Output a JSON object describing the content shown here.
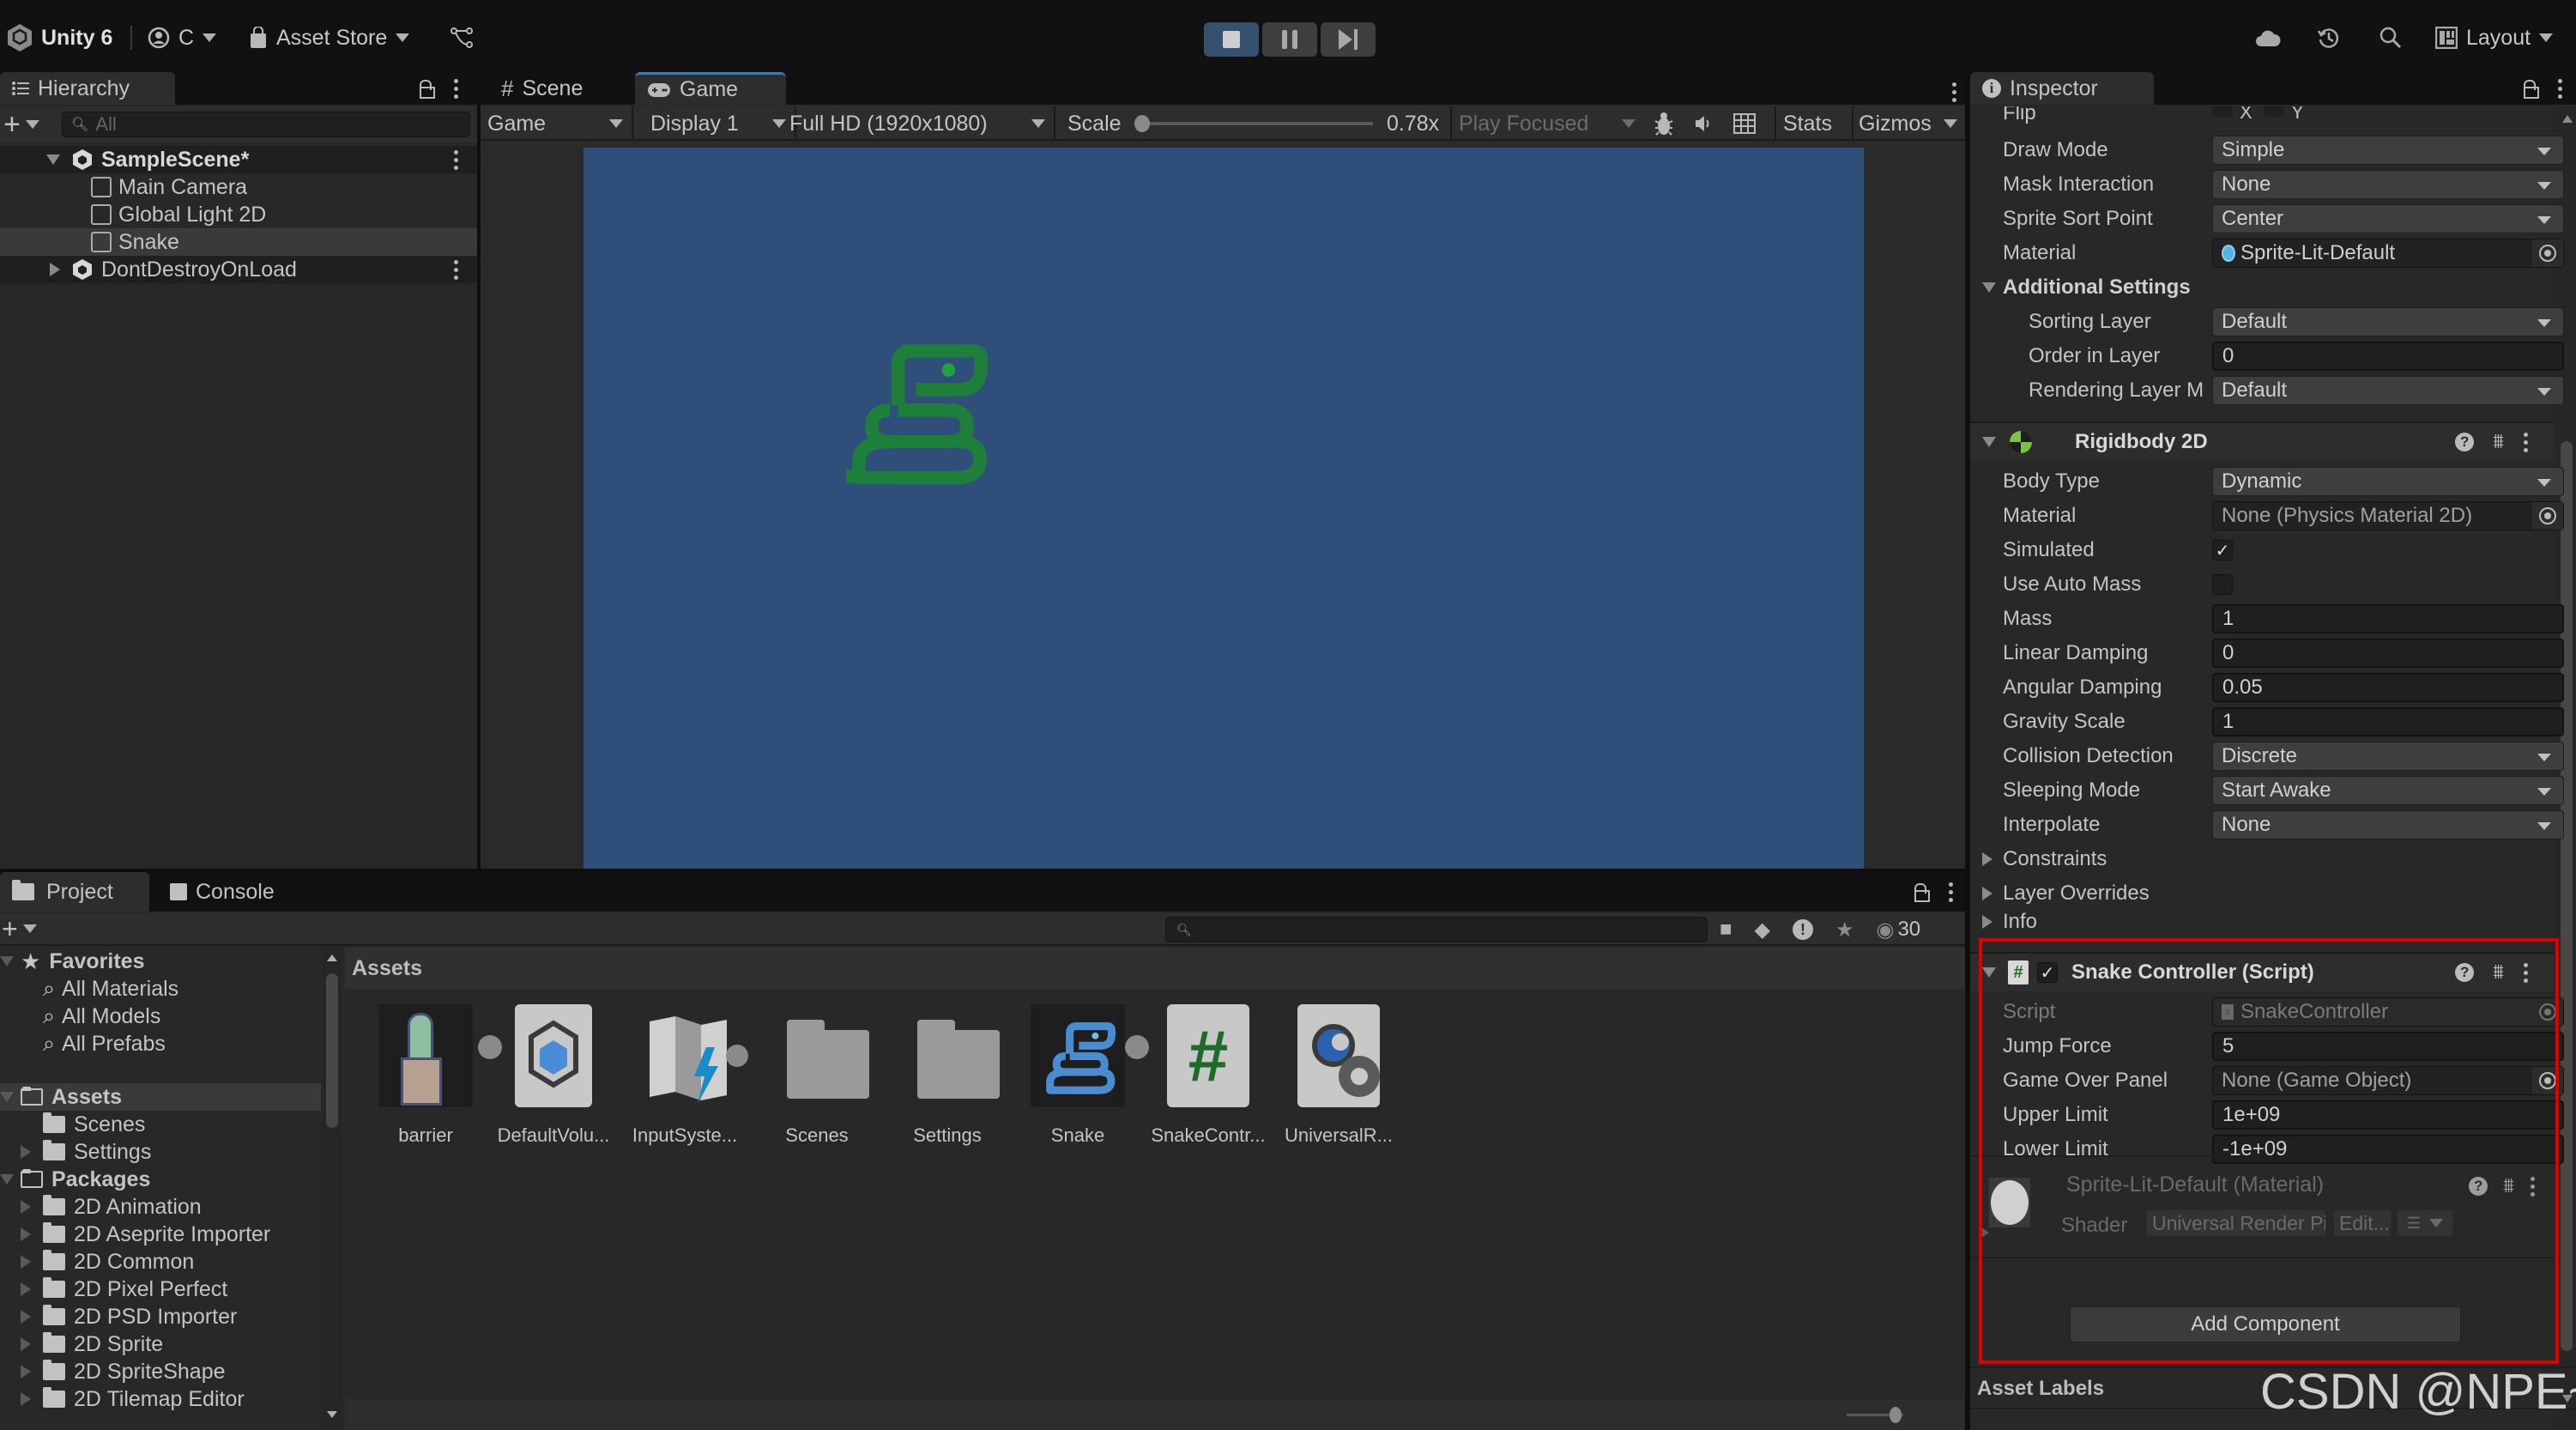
{
  "toolbar": {
    "app_title": "Unity 6",
    "account_label": "C",
    "asset_store_label": "Asset Store",
    "layout_label": "Layout",
    "play_controls": [
      "stop",
      "pause",
      "step"
    ]
  },
  "hierarchy": {
    "tab_label": "Hierarchy",
    "search_placeholder": "All",
    "items": [
      {
        "label": "SampleScene*",
        "type": "scene",
        "expanded": true
      },
      {
        "label": "Main Camera",
        "type": "gameobject"
      },
      {
        "label": "Global Light 2D",
        "type": "gameobject"
      },
      {
        "label": "Snake",
        "type": "gameobject",
        "selected": true
      },
      {
        "label": "DontDestroyOnLoad",
        "type": "scene",
        "expanded": false
      }
    ]
  },
  "game_view": {
    "tabs": [
      {
        "label": "Scene"
      },
      {
        "label": "Game",
        "active": true
      }
    ],
    "mode": "Game",
    "display": "Display 1",
    "resolution": "Full HD (1920x1080)",
    "scale_label": "Scale",
    "scale_value": "0.78x",
    "play_mode": "Play Focused",
    "stats_label": "Stats",
    "gizmos_label": "Gizmos",
    "background_color": "#2f4e7a",
    "sprite_color": "#1d7f3a"
  },
  "inspector": {
    "tab_label": "Inspector",
    "sprite_renderer": {
      "flip_label": "Flip",
      "flip_x": "X",
      "flip_y": "Y",
      "draw_mode": {
        "label": "Draw Mode",
        "value": "Simple"
      },
      "mask_interaction": {
        "label": "Mask Interaction",
        "value": "None"
      },
      "sprite_sort_point": {
        "label": "Sprite Sort Point",
        "value": "Center"
      },
      "material": {
        "label": "Material",
        "value": "Sprite-Lit-Default"
      },
      "additional_settings": "Additional Settings",
      "sorting_layer": {
        "label": "Sorting Layer",
        "value": "Default"
      },
      "order_in_layer": {
        "label": "Order in Layer",
        "value": "0"
      },
      "rendering_layer": {
        "label": "Rendering Layer M",
        "value": "Default"
      }
    },
    "rigidbody": {
      "title": "Rigidbody 2D",
      "body_type": {
        "label": "Body Type",
        "value": "Dynamic"
      },
      "material": {
        "label": "Material",
        "value": "None (Physics Material 2D)"
      },
      "simulated": {
        "label": "Simulated",
        "checked": true
      },
      "use_auto_mass": {
        "label": "Use Auto Mass",
        "checked": false
      },
      "mass": {
        "label": "Mass",
        "value": "1"
      },
      "linear_damping": {
        "label": "Linear Damping",
        "value": "0"
      },
      "angular_damping": {
        "label": "Angular Damping",
        "value": "0.05"
      },
      "gravity_scale": {
        "label": "Gravity Scale",
        "value": "1"
      },
      "collision_detection": {
        "label": "Collision Detection",
        "value": "Discrete"
      },
      "sleeping_mode": {
        "label": "Sleeping Mode",
        "value": "Start Awake"
      },
      "interpolate": {
        "label": "Interpolate",
        "value": "None"
      },
      "constraints": "Constraints",
      "layer_overrides": "Layer Overrides",
      "info": "Info"
    },
    "snake_controller": {
      "title": "Snake Controller (Script)",
      "enabled": true,
      "script": {
        "label": "Script",
        "value": "SnakeController"
      },
      "jump_force": {
        "label": "Jump Force",
        "value": "5"
      },
      "game_over_panel": {
        "label": "Game Over Panel",
        "value": "None (Game Object)"
      },
      "upper_limit": {
        "label": "Upper Limit",
        "value": "1e+09"
      },
      "lower_limit": {
        "label": "Lower Limit",
        "value": "-1e+09"
      }
    },
    "material_preview": {
      "title": "Sprite-Lit-Default (Material)",
      "shader_label": "Shader",
      "shader_value": "Universal Render Pip…",
      "edit_label": "Edit..."
    },
    "add_component_label": "Add Component",
    "asset_labels": "Asset Labels",
    "highlight_color": "#e00000"
  },
  "project": {
    "tabs": [
      {
        "label": "Project",
        "active": true
      },
      {
        "label": "Console"
      }
    ],
    "hidden_count": "30",
    "breadcrumb": "Assets",
    "tree": {
      "favorites": "Favorites",
      "favorite_items": [
        "All Materials",
        "All Models",
        "All Prefabs"
      ],
      "assets": "Assets",
      "asset_folders": [
        "Scenes",
        "Settings"
      ],
      "packages": "Packages",
      "package_folders": [
        "2D Animation",
        "2D Aseprite Importer",
        "2D Common",
        "2D Pixel Perfect",
        "2D PSD Importer",
        "2D Sprite",
        "2D SpriteShape",
        "2D Tilemap Editor"
      ]
    },
    "assets": [
      {
        "label": "barrier",
        "icon": "cactus-sprite-icon"
      },
      {
        "label": "DefaultVolu...",
        "icon": "volume-profile-icon"
      },
      {
        "label": "InputSyste...",
        "icon": "input-actions-icon"
      },
      {
        "label": "Scenes",
        "icon": "folder-icon"
      },
      {
        "label": "Settings",
        "icon": "folder-icon"
      },
      {
        "label": "Snake",
        "icon": "snake-sprite-icon"
      },
      {
        "label": "SnakeContr...",
        "icon": "csharp-script-icon"
      },
      {
        "label": "UniversalR...",
        "icon": "render-pipeline-asset-icon"
      }
    ]
  },
  "watermark": "CSDN @NPE~"
}
